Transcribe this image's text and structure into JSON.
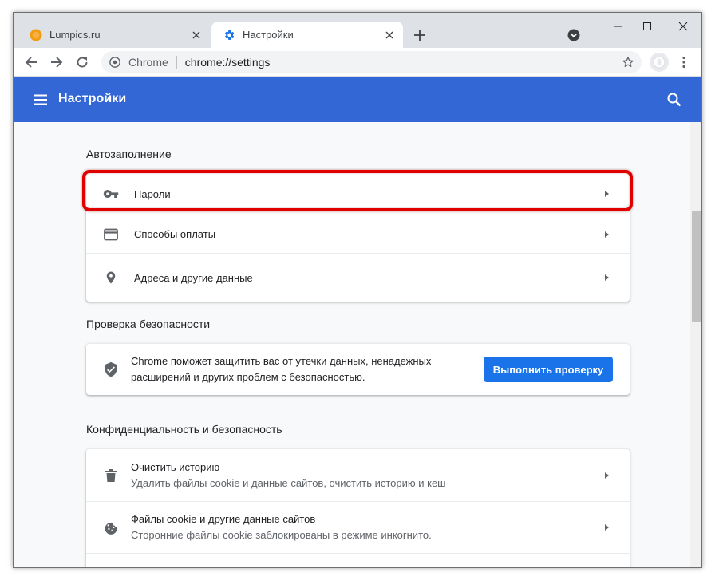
{
  "tabs": [
    {
      "title": "Lumpics.ru",
      "favicon": "orange-circle-icon",
      "active": false
    },
    {
      "title": "Настройки",
      "favicon": "gear-icon",
      "active": true
    }
  ],
  "toolbar": {
    "omnibox_origin": "Chrome",
    "omnibox_url": "chrome://settings"
  },
  "header": {
    "title": "Настройки"
  },
  "autofill": {
    "title": "Автозаполнение",
    "items": [
      {
        "label": "Пароли",
        "icon": "key-icon"
      },
      {
        "label": "Способы оплаты",
        "icon": "credit-card-icon"
      },
      {
        "label": "Адреса и другие данные",
        "icon": "location-pin-icon"
      }
    ]
  },
  "safety_check": {
    "title": "Проверка безопасности",
    "description_line1": "Chrome поможет защитить вас от утечки данных, ненадежных",
    "description_line2": "расширений и других проблем с безопасностью.",
    "button_label": "Выполнить проверку",
    "icon": "shield-check-icon"
  },
  "privacy": {
    "title": "Конфиденциальность и безопасность",
    "items": [
      {
        "title": "Очистить историю",
        "subtitle": "Удалить файлы cookie и данные сайтов, очистить историю и кеш",
        "icon": "trash-icon"
      },
      {
        "title": "Файлы cookie и другие данные сайтов",
        "subtitle": "Сторонние файлы cookie заблокированы в режиме инкогнито.",
        "icon": "cookie-icon"
      }
    ]
  },
  "colors": {
    "header_blue": "#3367d6",
    "button_blue": "#1a73e8",
    "highlight_red": "#e10000"
  }
}
